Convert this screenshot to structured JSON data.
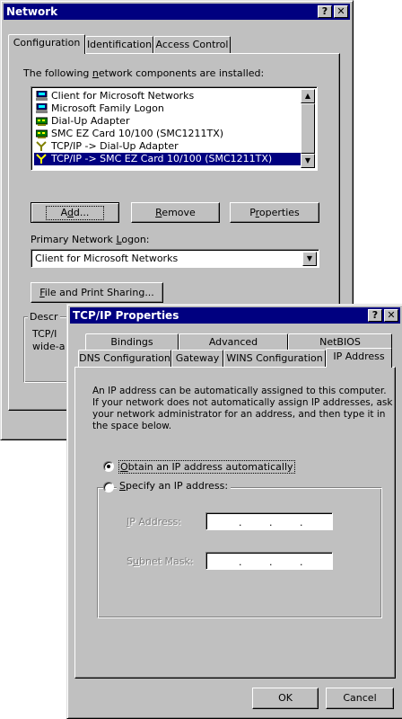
{
  "network_window": {
    "title": "Network",
    "title_buttons": {
      "help": "?",
      "close": "✕"
    },
    "tabs": [
      "Configuration",
      "Identification",
      "Access Control"
    ],
    "components_label": "The following network components are installed:",
    "components": [
      {
        "label": "Client for Microsoft Networks",
        "icon": "network-client-icon",
        "selected": false
      },
      {
        "label": "Microsoft Family Logon",
        "icon": "network-client-icon",
        "selected": false
      },
      {
        "label": "Dial-Up Adapter",
        "icon": "network-adapter-icon",
        "selected": false
      },
      {
        "label": "SMC EZ Card 10/100 (SMC1211TX)",
        "icon": "network-adapter-icon",
        "selected": false
      },
      {
        "label": "TCP/IP -> Dial-Up Adapter",
        "icon": "protocol-icon",
        "selected": false
      },
      {
        "label": "TCP/IP -> SMC EZ Card 10/100 (SMC1211TX)",
        "icon": "protocol-icon",
        "selected": true
      }
    ],
    "add_button": "Add...",
    "remove_button": "Remove",
    "properties_button": "Properties",
    "primary_logon_label": "Primary Network Logon:",
    "primary_logon_value": "Client for Microsoft Networks",
    "file_print_button": "File and Print Sharing...",
    "description_label": "Descr",
    "description_lines": [
      "TCP/I",
      "wide-a"
    ]
  },
  "tcpip_window": {
    "title": "TCP/IP Properties",
    "title_buttons": {
      "help": "?",
      "close": "✕"
    },
    "tabs_back": [
      "Bindings",
      "Advanced",
      "NetBIOS"
    ],
    "tabs_front": [
      "DNS Configuration",
      "Gateway",
      "WINS Configuration",
      "IP Address"
    ],
    "active_tab": "IP Address",
    "description_lines": [
      "An IP address can be automatically assigned to this computer.",
      "If your network does not automatically assign IP addresses, ask",
      "your network administrator for an address, and then type it in",
      "the space below."
    ],
    "radio_auto": "Obtain an IP address automatically",
    "radio_specify": "Specify an IP address:",
    "ip_address_label": "IP Address:",
    "subnet_mask_label": "Subnet Mask:",
    "ip_separator": ".",
    "ok_button": "OK",
    "cancel_button": "Cancel"
  },
  "colors": {
    "face": "#c0c0c0",
    "titlebar": "#000080",
    "selection": "#000080",
    "disabled_text": "#808080"
  }
}
